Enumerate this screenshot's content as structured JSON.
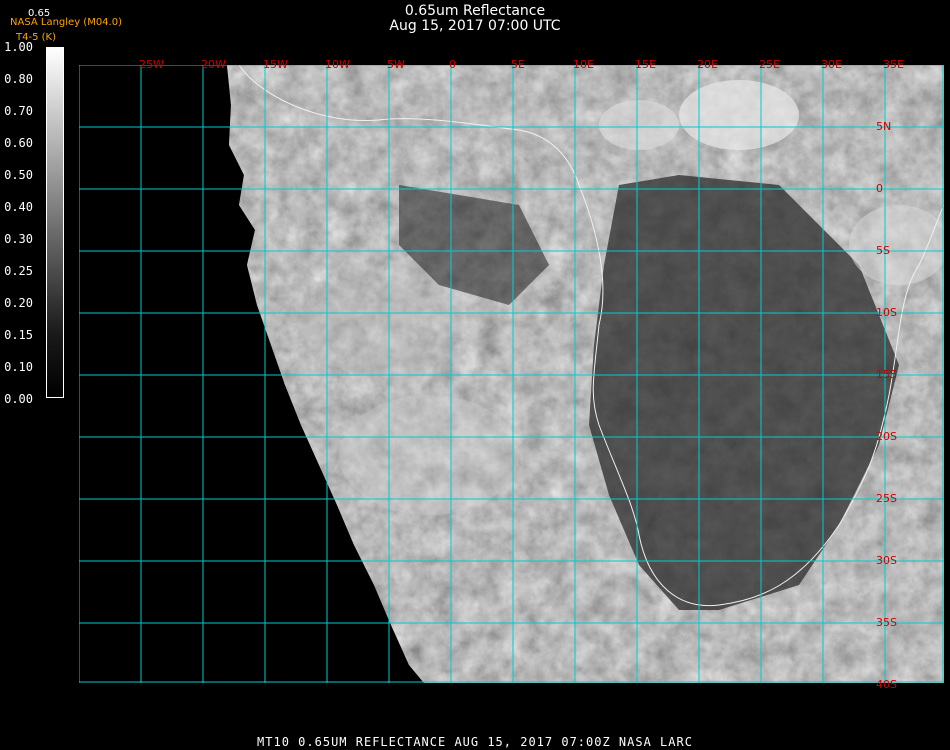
{
  "header": {
    "title": "0.65um Reflectance",
    "date": "Aug 15, 2017 07:00 UTC",
    "version_top": "0.65",
    "org": "NASA Langley (M04.0)",
    "source": "T4-5 (K)"
  },
  "colorbar": {
    "ticks": [
      "1.00",
      "0.80",
      "0.70",
      "0.60",
      "0.50",
      "0.40",
      "0.30",
      "0.25",
      "0.20",
      "0.15",
      "0.10",
      "0.00"
    ],
    "colors": [
      "#ffffff",
      "#e6e6e6",
      "#cccccc",
      "#b3b3b3",
      "#999999",
      "#808080",
      "#666666",
      "#4d4d4d",
      "#333333",
      "#1a1a1a",
      "#0d0d0d",
      "#000000"
    ]
  },
  "grid": {
    "line_color": "#00cccc",
    "label_color": "#cc0000",
    "lon_labels": [
      "25W",
      "20W",
      "15W",
      "10W",
      "5W",
      "0",
      "5E",
      "10E",
      "15E",
      "20E",
      "25E",
      "30E",
      "35E"
    ],
    "lat_labels": [
      "5N",
      "0",
      "5S",
      "10S",
      "15S",
      "20S",
      "25S",
      "30S",
      "35S",
      "40S"
    ]
  },
  "footer": {
    "text": "MT10  0.65UM REFLECTANCE   AUG 15, 2017 07:00Z   NASA LARC"
  }
}
